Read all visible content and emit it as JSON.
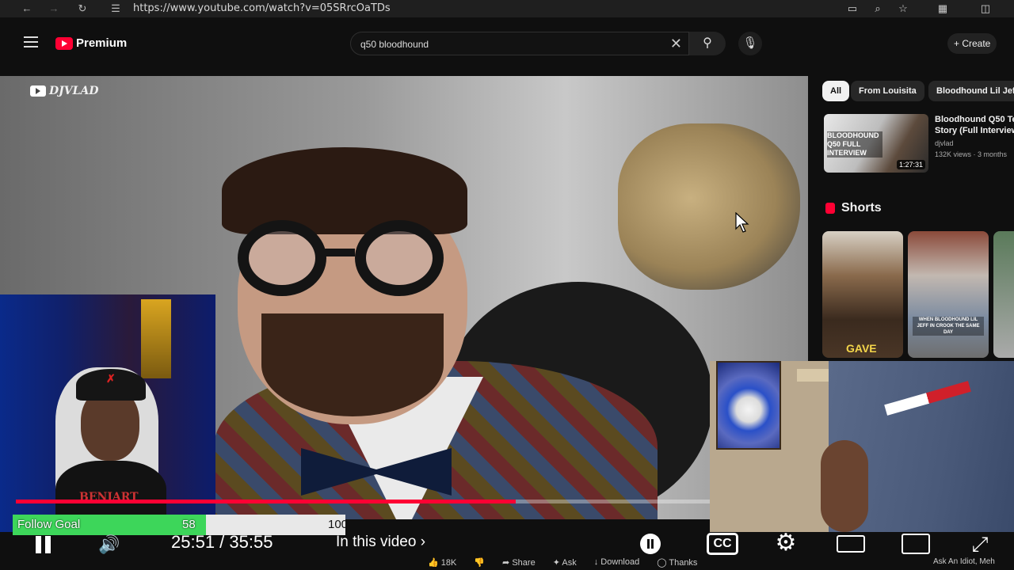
{
  "browser": {
    "url": "https://www.youtube.com/watch?v=05SRrcOaTDs",
    "back_icon": "arrow-left-icon",
    "forward_icon": "arrow-right-icon",
    "reload_icon": "reload-icon"
  },
  "header": {
    "logo_text": "Premium",
    "search_value": "q50 bloodhound",
    "create_label": "+ Create"
  },
  "video": {
    "channel_watermark": "DJVLAD"
  },
  "sidebar": {
    "chips": [
      "All",
      "From Louisita",
      "Bloodhound Lil Jeff"
    ],
    "recommendation": {
      "thumb_text": "BLOODHOUND Q50 FULL INTERVIEW",
      "duration": "1:27:31",
      "title_line1": "Bloodhound Q50 Tel",
      "title_line2": "Story (Full Interview)",
      "channel": "djvlad",
      "meta": "132K views · 3 months"
    },
    "shorts_label": "Shorts",
    "short_1_text": "GAVE",
    "short_2_caption": "WHEN BLOODHOUND LIL JEFF IN CROOK THE SAME DAY"
  },
  "webcam_left": {
    "shirt_text": "BENJART"
  },
  "player": {
    "progress_fraction": 0.72,
    "time": "25:51 / 35:55",
    "chapter_label": "In this video",
    "cc_label": "CC"
  },
  "follow_goal": {
    "label": "Follow Goal",
    "current": "58",
    "target": "100",
    "fraction": 0.58
  },
  "actions": {
    "likes": "18K",
    "share": "Share",
    "ask": "Ask",
    "download": "Download",
    "thanks": "Thanks"
  },
  "footer": {
    "bottom_right": "Ask An Idiot, Meh"
  }
}
